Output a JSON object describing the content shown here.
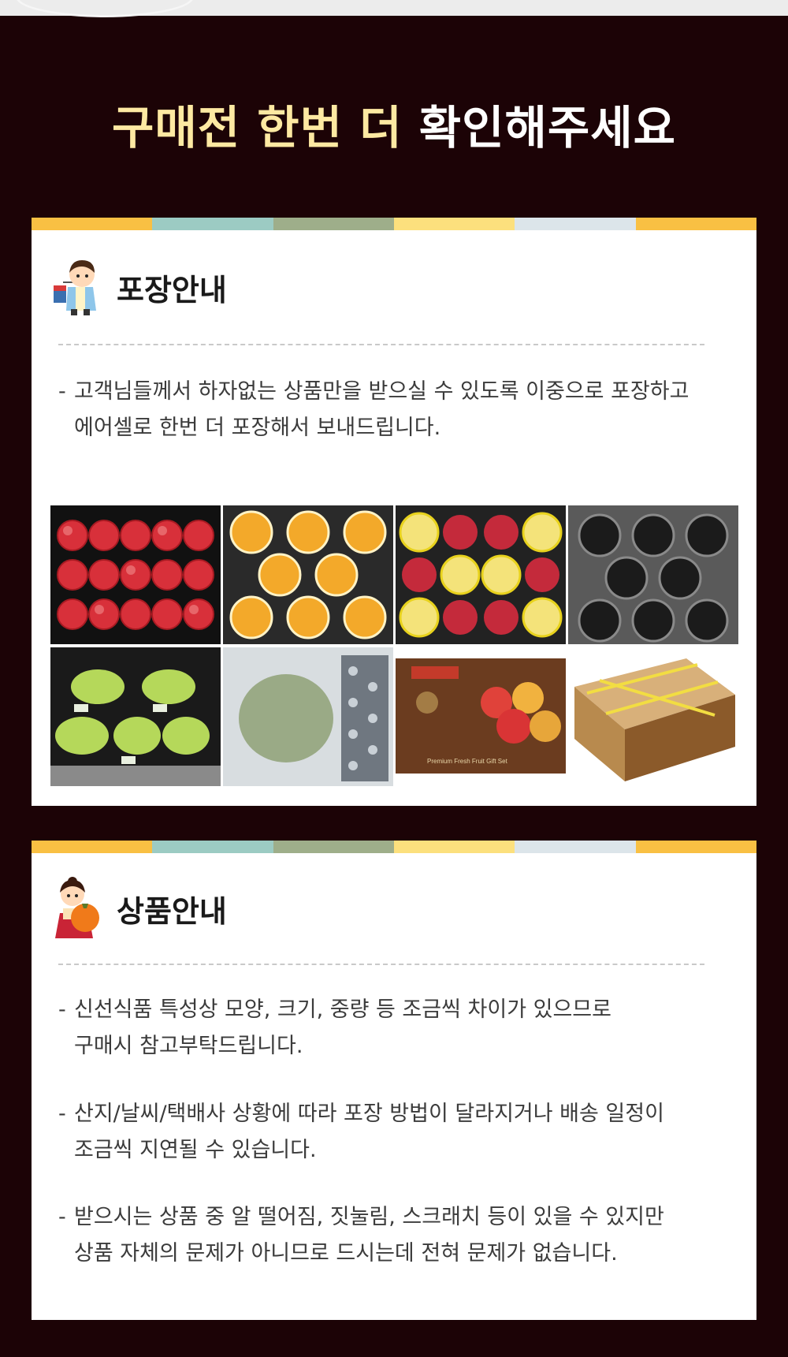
{
  "header": {
    "title_part1": "구매전 한번 더",
    "title_part2": "확인해주세요"
  },
  "colors": {
    "background": "#1c0306",
    "title_highlight": "#fde9a2",
    "stripe": [
      "#f9c043",
      "#9ccbc3",
      "#9eae8a",
      "#fce07d",
      "#dce5ea",
      "#f9c043"
    ]
  },
  "packaging": {
    "title": "포장안내",
    "icon": "boy-with-lantern-icon",
    "text_line1": "고객님들께서 하자없는 상품만을 받으실 수 있도록 이중으로 포장하고",
    "text_line2": "에어셀로 한번 더 포장해서 보내드립니다.",
    "photos": [
      {
        "name": "apple-tray-photo"
      },
      {
        "name": "pear-tray-photo"
      },
      {
        "name": "mixed-fruit-tray-photo"
      },
      {
        "name": "empty-tray-photo"
      },
      {
        "name": "grape-bags-photo"
      },
      {
        "name": "air-cell-bag-photo"
      },
      {
        "name": "gift-box-photo",
        "label": "Premium Fresh Fruit Gift Set"
      },
      {
        "name": "taped-box-photo"
      }
    ]
  },
  "product": {
    "title": "상품안내",
    "icon": "girl-with-persimmon-icon",
    "items": [
      {
        "line1": "신선식품 특성상 모양, 크기, 중량 등 조금씩 차이가 있으므로",
        "line2": "구매시 참고부탁드립니다."
      },
      {
        "line1": "산지/날씨/택배사 상황에 따라 포장 방법이 달라지거나 배송 일정이",
        "line2": "조금씩 지연될 수 있습니다."
      },
      {
        "line1": "받으시는 상품 중 알 떨어짐, 짓눌림, 스크래치 등이 있을 수 있지만",
        "line2": "상품 자체의 문제가 아니므로 드시는데 전혀 문제가 없습니다."
      }
    ]
  }
}
